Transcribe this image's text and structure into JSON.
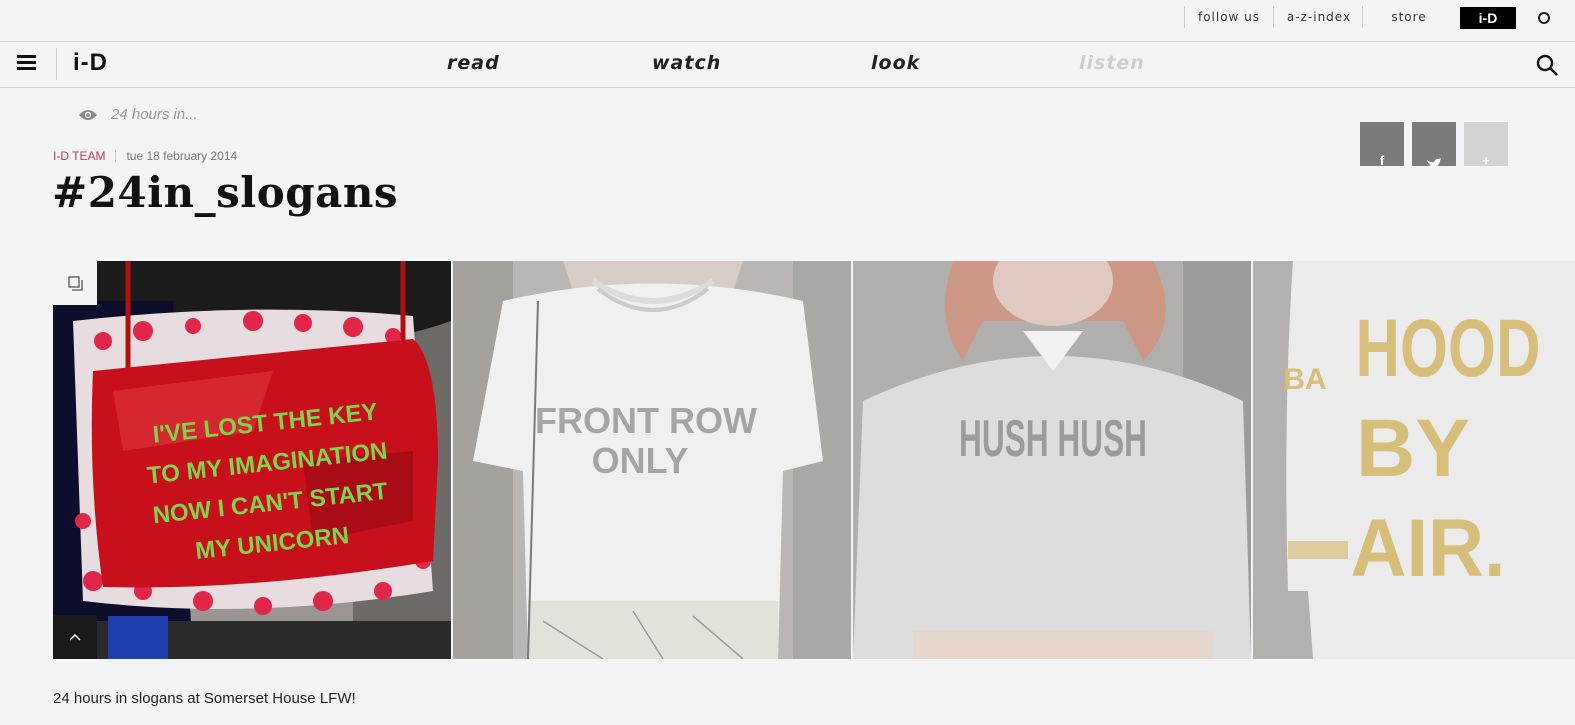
{
  "utility_bar": {
    "items": [
      "follow us",
      "a-z-index",
      "store"
    ],
    "logo": "i-D"
  },
  "nav": {
    "logo": "i-D",
    "links": [
      {
        "label": "read"
      },
      {
        "label": "watch"
      },
      {
        "label": "look"
      },
      {
        "label": "listen"
      }
    ]
  },
  "article": {
    "series": "24 hours in...",
    "author": "i-D Team",
    "date": "tue 18 february 2014",
    "title": "#24in_slogans",
    "caption": "24 hours in slogans at Somerset House LFW!"
  },
  "share": {
    "facebook_icon": "facebook-icon",
    "twitter_icon": "twitter-icon",
    "plus_icon": "plus-icon"
  },
  "gallery": {
    "photos": [
      {
        "lines": [
          "I'VE LOST THE KEY",
          "TO MY IMAGINATION",
          "NOW I CAN'T START",
          "MY UNICORN"
        ]
      },
      {
        "lines": [
          "FRONT ROW",
          "ONLY"
        ]
      },
      {
        "lines": [
          "HUSH HUSH"
        ]
      },
      {
        "lines": [
          "HOOD",
          "BY",
          "AIR."
        ],
        "side_text": "BA"
      }
    ]
  },
  "colors": {
    "background": "#f3f4f6",
    "author": "#c0365c",
    "bag": "#c8101c",
    "bag_text": "#7ed44a",
    "gold": "#c9a13a"
  }
}
